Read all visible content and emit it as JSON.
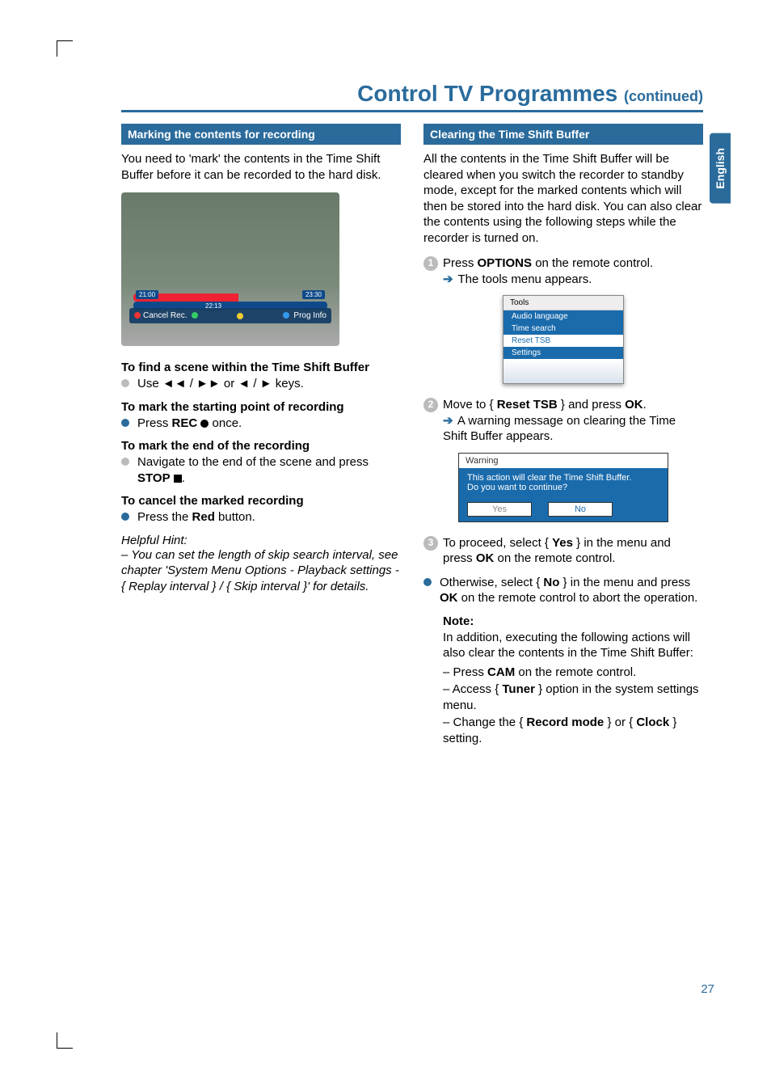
{
  "page_title_main": "Control TV Programmes",
  "page_title_cont": "(continued)",
  "side_tab": "English",
  "page_number": "27",
  "left": {
    "section_heading": "Marking the contents for recording",
    "intro": "You need to 'mark' the contents in the Time Shift Buffer before it can be recorded to the hard disk.",
    "screenshot": {
      "time_left": "21:00",
      "time_mid": "22:13",
      "time_right": "23:30",
      "bar_left": "Cancel Rec.",
      "bar_right": "Prog Info"
    },
    "sub1_title": "To find a scene within the Time Shift Buffer",
    "sub1_bullet": "Use ◄◄ / ►► or ◄ / ► keys.",
    "sub2_title": "To mark the starting point of recording",
    "sub2_bullet_pre": "Press ",
    "sub2_bullet_bold": "REC",
    "sub2_bullet_post": " once.",
    "sub3_title": "To mark the end of the recording",
    "sub3_bullet": "Navigate to the end of the scene and press ",
    "sub3_bullet_bold": "STOP",
    "sub3_bullet_post": ".",
    "sub4_title": "To cancel the marked recording",
    "sub4_bullet_pre": "Press the ",
    "sub4_bullet_bold": "Red",
    "sub4_bullet_post": " button.",
    "hint_label": "Helpful Hint:",
    "hint_body": "– You can set the length of skip search interval, see chapter 'System Menu Options - Playback settings - { Replay interval } / { Skip interval }' for details."
  },
  "right": {
    "section_heading": "Clearing the Time Shift Buffer",
    "intro": "All the contents in the Time Shift Buffer will be cleared when you switch the recorder to standby mode, except for the marked contents which will then be stored into the hard disk. You can also clear the contents using the following steps while the recorder is turned on.",
    "step1_pre": "Press ",
    "step1_bold": "OPTIONS",
    "step1_post": " on the remote control.",
    "step1_result": "The tools menu appears.",
    "tools_menu": {
      "title": "Tools",
      "items": [
        "Audio language",
        "Time search",
        "Reset TSB",
        "Settings"
      ]
    },
    "step2_pre": "Move to { ",
    "step2_bold": "Reset TSB",
    "step2_mid": " } and press ",
    "step2_bold2": "OK",
    "step2_post": ".",
    "step2_result": "A warning message on clearing the Time Shift Buffer appears.",
    "warning": {
      "title": "Warning",
      "line1": "This action will clear the Time Shift Buffer.",
      "line2": "Do you want to continue?",
      "yes": "Yes",
      "no": "No"
    },
    "step3_pre": "To proceed, select { ",
    "step3_bold": "Yes",
    "step3_mid": " } in the menu and press ",
    "step3_bold2": "OK",
    "step3_post": " on the remote control.",
    "otherwise_pre": "Otherwise, select { ",
    "otherwise_bold": "No",
    "otherwise_mid": " } in the menu and press ",
    "otherwise_bold2": "OK",
    "otherwise_post": " on the remote control to abort the operation.",
    "note_label": "Note:",
    "note_intro": "In addition, executing the following actions will also clear the contents in the Time Shift Buffer:",
    "note_item1_pre": "– Press ",
    "note_item1_bold": "CAM",
    "note_item1_post": " on the remote control.",
    "note_item2_pre": "– Access { ",
    "note_item2_bold": "Tuner",
    "note_item2_post": " } option in the system settings menu.",
    "note_item3_pre": "– Change the { ",
    "note_item3_bold": "Record mode",
    "note_item3_mid": " } or { ",
    "note_item3_bold2": "Clock",
    "note_item3_post": " } setting."
  }
}
